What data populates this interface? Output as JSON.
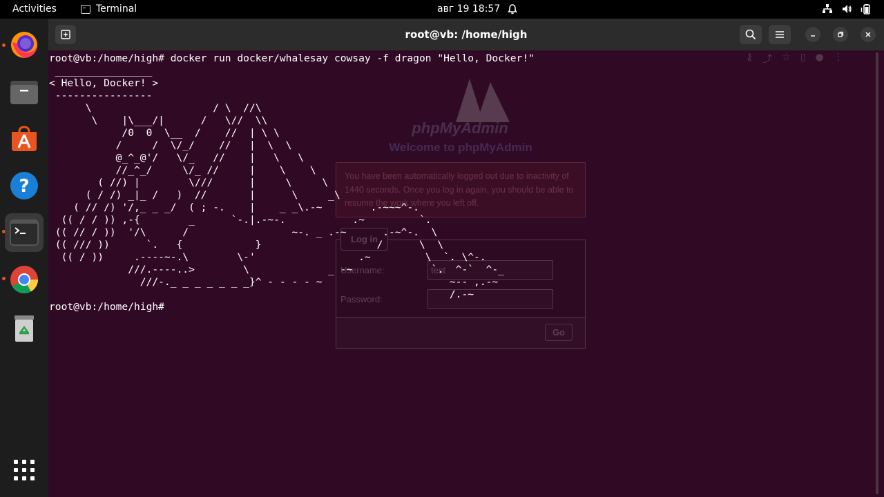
{
  "topbar": {
    "activities": "Activities",
    "app_name": "Terminal",
    "clock": "авг 19  18:57"
  },
  "dock": {
    "items": [
      {
        "icon": "firefox-icon",
        "name": "Firefox",
        "running": true
      },
      {
        "icon": "files-icon",
        "name": "Files",
        "running": false
      },
      {
        "icon": "app-center-icon",
        "name": "App Center",
        "running": false
      },
      {
        "icon": "help-icon",
        "name": "Help",
        "running": false
      },
      {
        "icon": "terminal-icon",
        "name": "Terminal",
        "running": true,
        "active": true
      },
      {
        "icon": "chrome-icon",
        "name": "Chrome",
        "running": true
      },
      {
        "icon": "trash-icon",
        "name": "Trash",
        "running": false
      }
    ],
    "show_apps_icon": "grid-icon"
  },
  "window": {
    "title": "root@vb: /home/high"
  },
  "terminal": {
    "lines": [
      "root@vb:/home/high# docker run docker/whalesay cowsay -f dragon \"Hello, Docker!\"",
      " ________________",
      "< Hello, Docker! >",
      " ----------------",
      "      \\                    / \\  //\\",
      "       \\    |\\___/|      /   \\//  \\\\",
      "            /0  0  \\__  /    //  | \\ \\",
      "           /     /  \\/_/    //   |  \\  \\",
      "           @_^_@'/   \\/_   //    |   \\   \\",
      "           //_^_/     \\/_ //     |    \\    \\",
      "        ( //) |        \\///      |     \\     \\",
      "      ( / /) _|_ /   )  //       |      \\     _\\",
      "    ( // /) '/,_ _ _/  ( ; -.    |    _ _\\.-~        .-~~~^-.",
      "  (( / / )) ,-{        _      `-.|.-~-.           .~         `.",
      " (( // / ))  '/\\      /                 ~-. _ .-~      .-~^-.  \\",
      " (( /// ))      `.   {            }                   /      \\  \\",
      "  (( / ))     .----~-.\\        \\-'                 .~         \\  `. \\^-.",
      "             ///.----..>        \\             _ -~             `.  ^-`  ^-_",
      "               ///-._ _ _ _ _ _ _}^ - - - - ~                     ~-- ,.-~",
      "                                                                  /.-~",
      "root@vb:/home/high# "
    ]
  },
  "ghost_browser": {
    "logo": "phpMyAdmin",
    "welcome": "Welcome to phpMyAdmin",
    "error": "You have been automatically logged out due to inactivity of 1440 seconds. Once you log in again, you should be able to resume the work where you left off.",
    "login_legend": "Log in",
    "username_label": "Username:",
    "username_value": "test",
    "password_label": "Password:",
    "go_button": "Go"
  }
}
